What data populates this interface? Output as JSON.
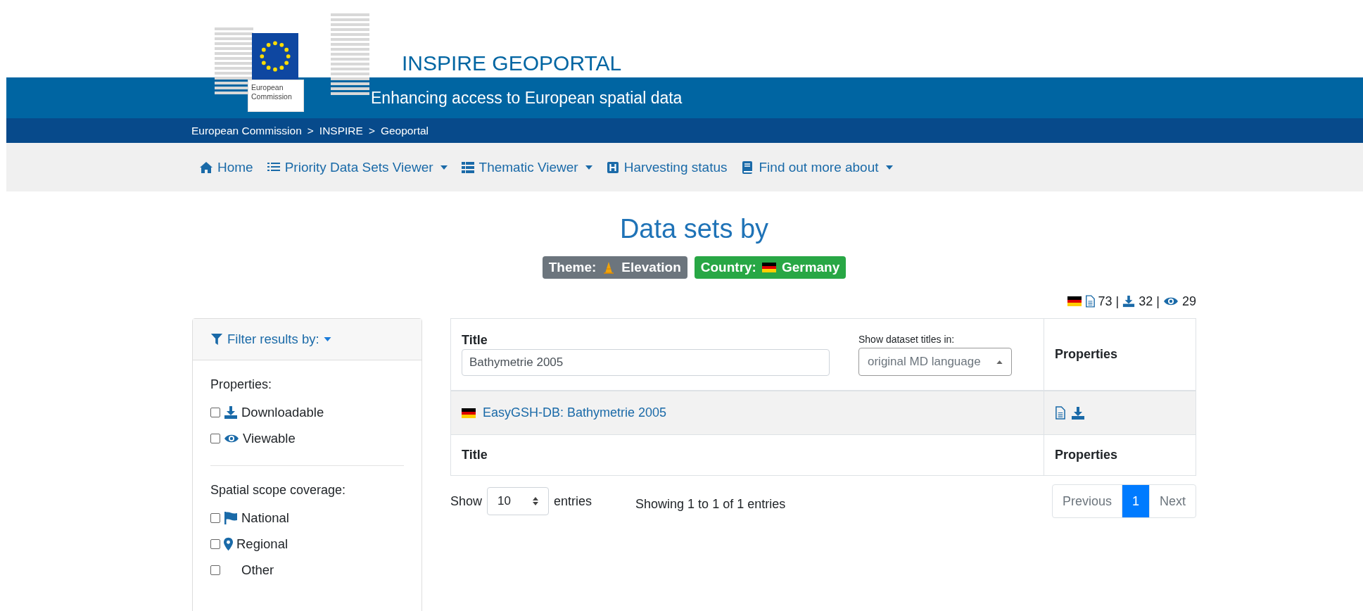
{
  "header": {
    "title": "INSPIRE GEOPORTAL",
    "tagline": "Enhancing access to European spatial data",
    "logo_text": [
      "European",
      "Commission"
    ]
  },
  "breadcrumb": {
    "separator": ">",
    "items": [
      "European Commission",
      "INSPIRE",
      "Geoportal"
    ]
  },
  "nav": [
    {
      "label": "Home",
      "kind": "home",
      "dropdown": false
    },
    {
      "label": "Priority Data Sets Viewer",
      "kind": "list",
      "dropdown": true
    },
    {
      "label": "Thematic Viewer",
      "kind": "grid",
      "dropdown": true
    },
    {
      "label": "Harvesting status",
      "kind": "h-square",
      "dropdown": false
    },
    {
      "label": "Find out more about",
      "kind": "book",
      "dropdown": true
    }
  ],
  "page_title": "Data sets by",
  "badges": [
    {
      "label": "Theme:",
      "value": "Elevation",
      "kind": "theme",
      "color": "#6c757d"
    },
    {
      "label": "Country:",
      "value": "Germany",
      "kind": "country",
      "color": "#28a745"
    }
  ],
  "counts": {
    "separator": "|",
    "items": [
      {
        "kind": "metadata",
        "value": "73"
      },
      {
        "kind": "download",
        "value": "32"
      },
      {
        "kind": "view",
        "value": "29"
      }
    ]
  },
  "filter": {
    "title": "Filter results by:",
    "groups": [
      {
        "heading": "Properties:",
        "options": [
          {
            "label": "Downloadable",
            "kind": "download",
            "checked": false
          },
          {
            "label": "Viewable",
            "kind": "view",
            "checked": false
          }
        ]
      },
      {
        "heading": "Spatial scope coverage:",
        "options": [
          {
            "label": "National",
            "kind": "flag",
            "checked": false
          },
          {
            "label": "Regional",
            "kind": "pin",
            "checked": false
          },
          {
            "label": "Other",
            "kind": "none",
            "checked": false
          }
        ]
      }
    ]
  },
  "table": {
    "columns": [
      "Title",
      "Properties"
    ],
    "search": {
      "value": "Bathymetrie 2005"
    },
    "language": {
      "label": "Show dataset titles in:",
      "value": "original MD language"
    },
    "rows": [
      {
        "title": "EasyGSH-DB: Bathymetrie 2005",
        "properties": [
          {
            "kind": "metadata"
          },
          {
            "kind": "download"
          }
        ]
      }
    ],
    "footer": [
      "Title",
      "Properties"
    ]
  },
  "length": {
    "before": "Show",
    "value": "10",
    "after": "entries"
  },
  "info": "Showing 1 to 1 of 1 entries",
  "pagination": [
    {
      "label": "Previous",
      "selected": false,
      "disabled": true
    },
    {
      "label": "1",
      "selected": true,
      "disabled": false
    },
    {
      "label": "Next",
      "selected": false,
      "disabled": true
    }
  ]
}
